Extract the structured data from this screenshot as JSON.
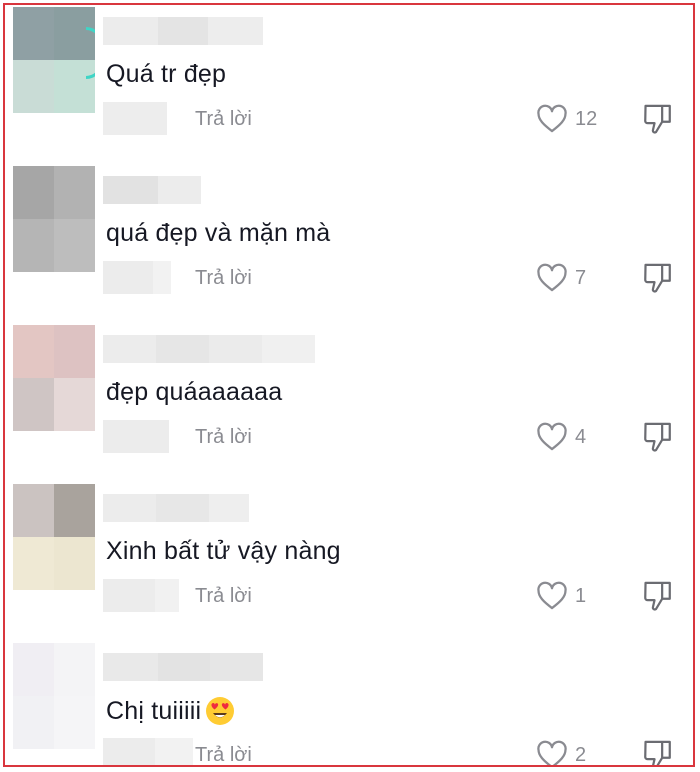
{
  "reply_label": "Trả lời",
  "colors": {
    "border": "#d9363e",
    "text": "#161823",
    "muted": "#8a8b91",
    "ring": "#3fd5c6"
  },
  "icons": {
    "like": "heart-outline-icon",
    "dislike": "thumbs-down-outline-icon"
  },
  "comments": [
    {
      "text": "Quá tr đẹp",
      "likes": "12",
      "emoji": ""
    },
    {
      "text": "quá đẹp và mặn mà",
      "likes": "7",
      "emoji": ""
    },
    {
      "text": "đẹp quáaaaaaa",
      "likes": "4",
      "emoji": ""
    },
    {
      "text": "Xinh bất tử vậy nàng",
      "likes": "1",
      "emoji": ""
    },
    {
      "text": "Chị tuiiiii",
      "likes": "2",
      "emoji": "heart-eyes-emoji"
    }
  ]
}
